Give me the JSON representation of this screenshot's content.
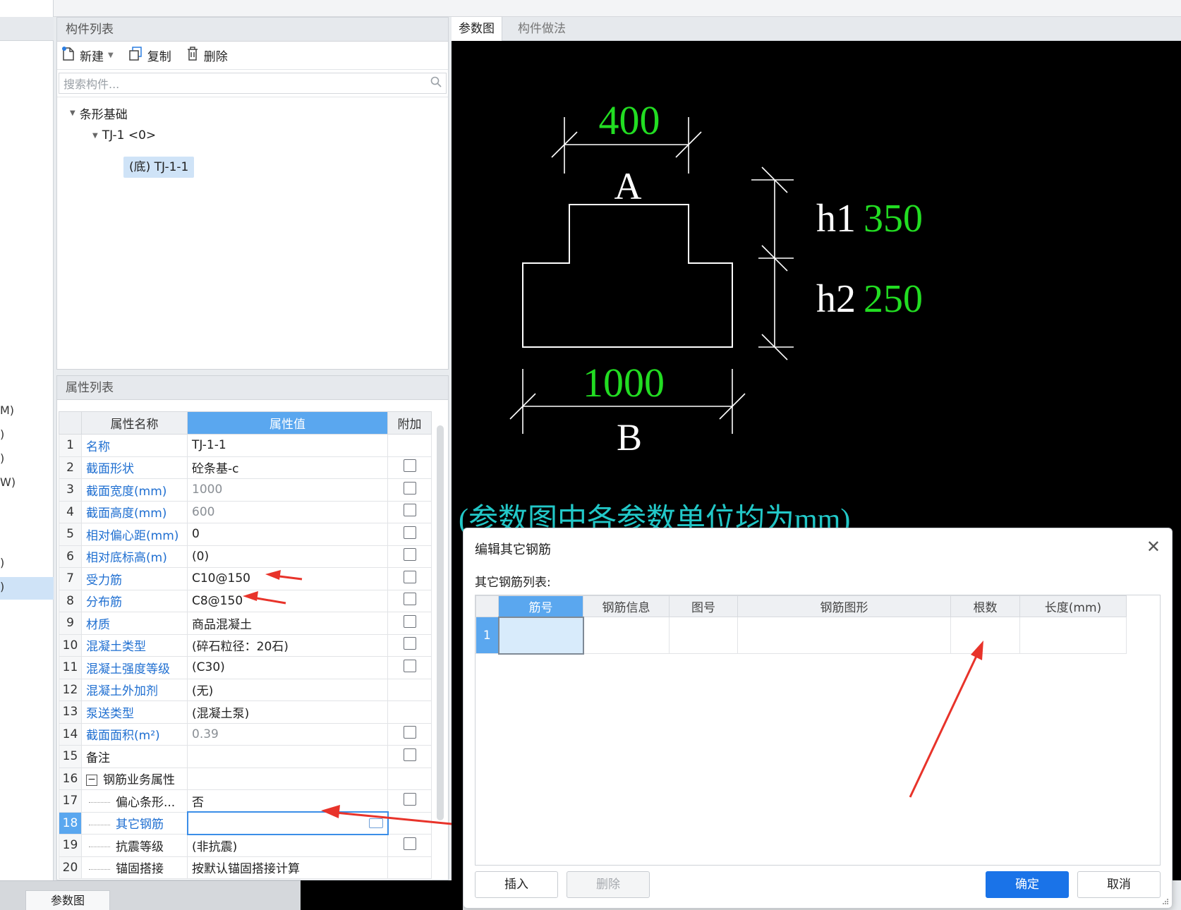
{
  "left_strip": {
    "fragments": [
      "M)",
      ")",
      ")",
      "W)",
      ")",
      ")"
    ]
  },
  "component_list": {
    "title": "构件列表",
    "toolbar": {
      "new_label": "新建",
      "copy_label": "复制",
      "delete_label": "删除"
    },
    "search_placeholder": "搜索构件...",
    "tree": {
      "root": "条形基础",
      "child": "TJ-1 <0>",
      "leaf": "(底) TJ-1-1"
    }
  },
  "properties": {
    "title": "属性列表",
    "columns": [
      "属性名称",
      "属性值",
      "附加"
    ],
    "rows": [
      {
        "no": "1",
        "name": "名称",
        "value": "TJ-1-1"
      },
      {
        "no": "2",
        "name": "截面形状",
        "value": "砼条基-c"
      },
      {
        "no": "3",
        "name": "截面宽度(mm)",
        "value": "1000"
      },
      {
        "no": "4",
        "name": "截面高度(mm)",
        "value": "600"
      },
      {
        "no": "5",
        "name": "相对偏心距(mm)",
        "value": "0"
      },
      {
        "no": "6",
        "name": "相对底标高(m)",
        "value": "(0)"
      },
      {
        "no": "7",
        "name": "受力筋",
        "value": "C10@150"
      },
      {
        "no": "8",
        "name": "分布筋",
        "value": "C8@150"
      },
      {
        "no": "9",
        "name": "材质",
        "value": "商品混凝土"
      },
      {
        "no": "10",
        "name": "混凝土类型",
        "value": "(碎石粒径：20石)"
      },
      {
        "no": "11",
        "name": "混凝土强度等级",
        "value": "(C30)"
      },
      {
        "no": "12",
        "name": "混凝土外加剂",
        "value": "(无)"
      },
      {
        "no": "13",
        "name": "泵送类型",
        "value": "(混凝土泵)"
      },
      {
        "no": "14",
        "name": "截面面积(m²)",
        "value": "0.39"
      },
      {
        "no": "15",
        "name": "备注",
        "value": ""
      },
      {
        "no": "16",
        "name": "钢筋业务属性",
        "value": ""
      },
      {
        "no": "17",
        "name": "偏心条形...",
        "value": "否"
      },
      {
        "no": "18",
        "name": "其它钢筋",
        "value": ""
      },
      {
        "no": "19",
        "name": "抗震等级",
        "value": "(非抗震)"
      },
      {
        "no": "20",
        "name": "锚固搭接",
        "value": "按默认锚固搭接计算"
      }
    ]
  },
  "view": {
    "tabs": [
      "参数图",
      "构件做法"
    ],
    "diagram": {
      "top_width_value": "400",
      "top_label": "A",
      "h1_label": "h1",
      "h1_value": "350",
      "h2_label": "h2",
      "h2_value": "250",
      "bottom_width_value": "1000",
      "bottom_label": "B",
      "unit_note": "(参数图中各参数单位均为mm)"
    }
  },
  "bottom_tab": "参数图",
  "dialog": {
    "title": "编辑其它钢筋",
    "close": "✕",
    "list_label": "其它钢筋列表:",
    "columns": [
      "筋号",
      "钢筋信息",
      "图号",
      "钢筋图形",
      "根数",
      "长度(mm)"
    ],
    "row_number": "1",
    "buttons": {
      "insert": "插入",
      "delete": "删除",
      "ok": "确定",
      "cancel": "取消"
    }
  },
  "colors": {
    "accent": "#5aa7ef",
    "primary_button": "#1a73e8",
    "diagram_green": "#22dd22",
    "diagram_cyan": "#22c8c8",
    "annotation_red": "#e8332a"
  }
}
